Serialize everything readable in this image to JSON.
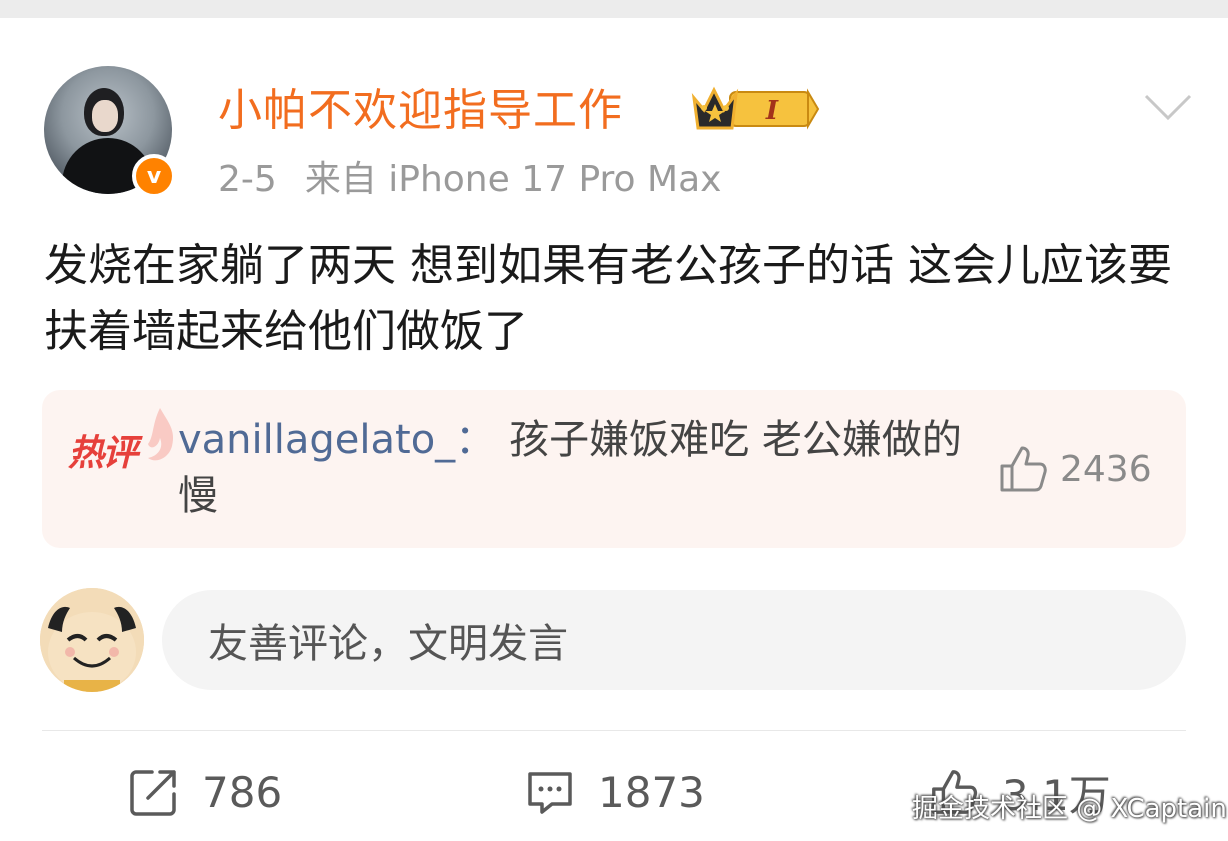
{
  "post": {
    "username": "小帕不欢迎指导工作",
    "vip_level": "I",
    "date": "2-5",
    "source": "来自 iPhone 17 Pro Max",
    "content": "发烧在家躺了两天 想到如果有老公孩子的话 这会儿应该要扶着墙起来给他们做饭了"
  },
  "hot_comment": {
    "tag": "热评",
    "user": "vanillagelato_",
    "colon": "：",
    "text": "孩子嫌饭难吃 老公嫌做的慢",
    "likes": "2436"
  },
  "comment_input": {
    "placeholder": "友善评论，文明发言"
  },
  "actions": {
    "reposts": "786",
    "comments": "1873",
    "likes": "3.1万"
  },
  "watermark": "掘金技术社区 @ XCaptain",
  "colors": {
    "username": "#f26d1f",
    "verified": "#ff8200",
    "hot_tag": "#e6403b",
    "link_user": "#506a95"
  }
}
